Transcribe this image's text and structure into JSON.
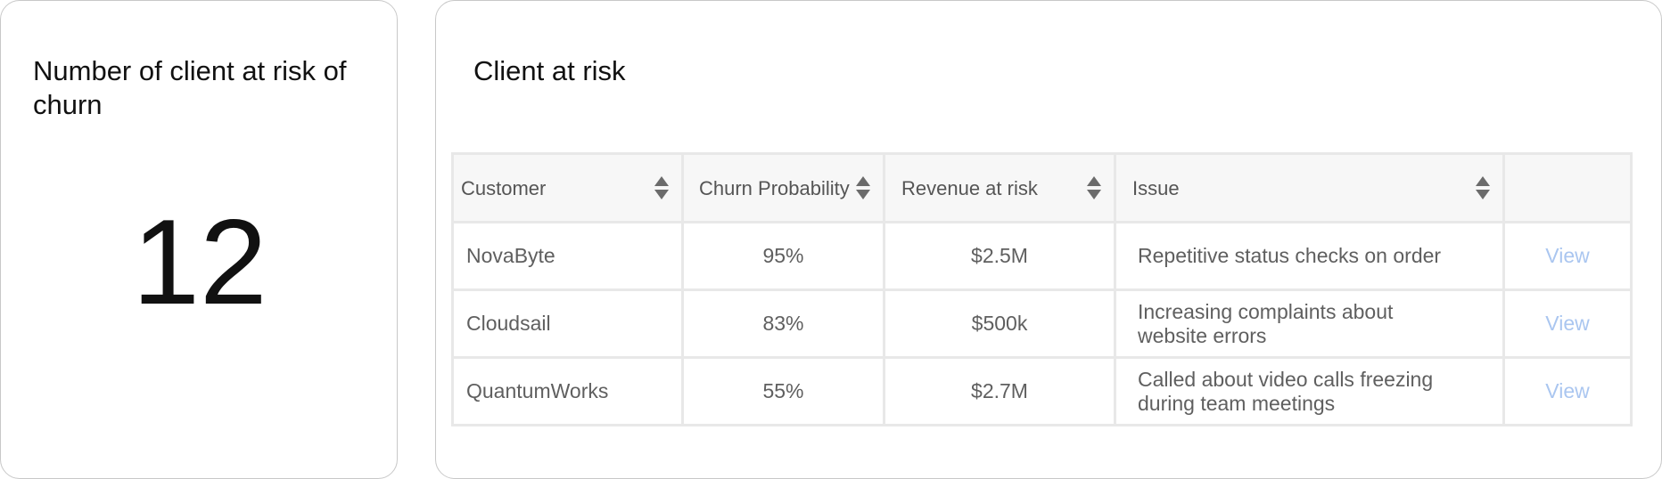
{
  "kpi": {
    "title": "Number of client at risk of churn",
    "value": "12"
  },
  "clients_table": {
    "title": "Client at risk",
    "columns": [
      {
        "label": "Customer",
        "sort_icon": "sort-icon"
      },
      {
        "label": "Churn Probability",
        "sort_icon": "sort-icon"
      },
      {
        "label": "Revenue at risk",
        "sort_icon": "sort-icon"
      },
      {
        "label": "Issue",
        "sort_icon": "sort-icon"
      },
      {
        "label": ""
      }
    ],
    "rows": [
      {
        "customer": "NovaByte",
        "churn_probability": "95%",
        "revenue_at_risk": "$2.5M",
        "issue": "Repetitive status checks on order",
        "action": "View"
      },
      {
        "customer": "Cloudsail",
        "churn_probability": "83%",
        "revenue_at_risk": "$500k",
        "issue": "Increasing complaints about website errors",
        "action": "View"
      },
      {
        "customer": "QuantumWorks",
        "churn_probability": "55%",
        "revenue_at_risk": "$2.7M",
        "issue": "Called about video calls freezing during team meetings",
        "action": "View"
      }
    ]
  },
  "colors": {
    "card_border": "#c8c8c8",
    "header_bg": "#f7f7f7",
    "cell_border": "#e8e8e8",
    "link": "#aac6f0"
  }
}
